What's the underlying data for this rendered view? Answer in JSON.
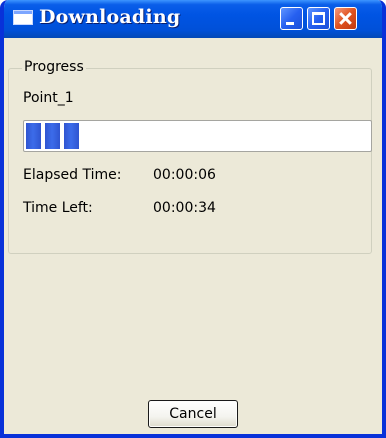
{
  "window": {
    "title": "Downloading",
    "buttons": {
      "minimize": "minimize-icon",
      "maximize": "maximize-icon",
      "close": "close-icon"
    }
  },
  "progress_group": {
    "legend": "Progress",
    "item_name": "Point_1",
    "progress_fraction": 0.19,
    "elapsed_label": "Elapsed Time:",
    "elapsed_value": "00:00:06",
    "time_left_label": "Time Left:",
    "time_left_value": "00:00:34"
  },
  "actions": {
    "cancel_label": "Cancel"
  },
  "colors": {
    "titlebar": "#0054e3",
    "window_face": "#ece9d8",
    "progress_fill": "#2f55d0",
    "close_button": "#e0521f"
  }
}
